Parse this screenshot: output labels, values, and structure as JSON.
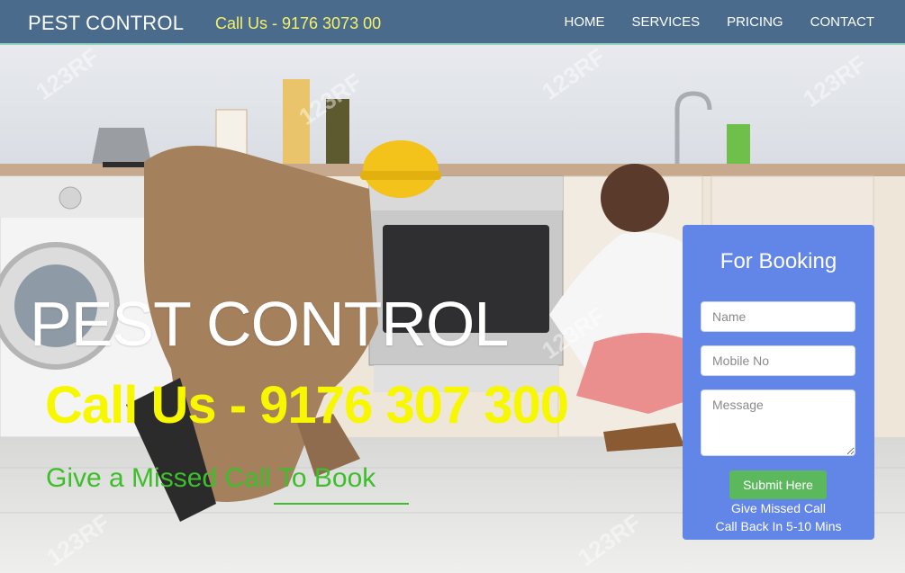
{
  "nav": {
    "brand": "PEST CONTROL",
    "phone": "Call Us - 9176 3073 00",
    "links": [
      {
        "label": "HOME"
      },
      {
        "label": "SERVICES"
      },
      {
        "label": "PRICING"
      },
      {
        "label": "CONTACT"
      }
    ]
  },
  "hero": {
    "title": "PEST CONTROL",
    "phone": "Call Us - 9176 307 300",
    "missed_call": "Give a Missed Call To Book",
    "watermark": "123RF"
  },
  "booking": {
    "title": "For Booking",
    "name_placeholder": "Name",
    "mobile_placeholder": "Mobile No",
    "message_placeholder": "Message",
    "submit_label": "Submit Here",
    "note_line1": "Give Missed Call",
    "note_line2": "Call Back In 5-10 Mins"
  },
  "colors": {
    "navbar": "#4a6b8b",
    "nav_phone": "#f5f26a",
    "hero_phone": "#f7f700",
    "missed_call": "#3cbf2a",
    "booking_panel": "#6285e8",
    "submit": "#5cb85c"
  }
}
